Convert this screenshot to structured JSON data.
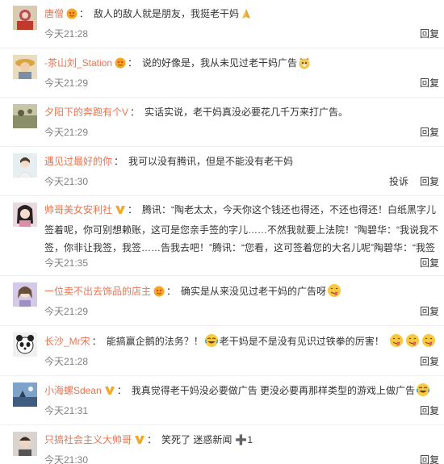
{
  "colors": {
    "username": "#eb7350",
    "text": "#333333",
    "time": "#808080",
    "vip_badge": "#f5a623",
    "divider": "#eeeeee"
  },
  "comments": [
    {
      "username": "唐僧",
      "badge": "vip-face-badge",
      "colon": "：",
      "text": "敌人的敌人就是朋友，我挺老干妈",
      "trailing_emoji": "pray-hands-emoji",
      "time": "今天21:28",
      "actions": [
        "回复"
      ]
    },
    {
      "username": "-茶山刘_Station",
      "badge": "vip-face-badge",
      "colon": "：",
      "text": "说的好像是，我从未见过老干妈广告",
      "trailing_emoji": "doge-emoji",
      "time": "今天21:29",
      "actions": [
        "回复"
      ]
    },
    {
      "username": "夕阳下的奔跑有个V",
      "colon": "：",
      "text": "实话实说，老干妈真没必要花几千万来打广告。",
      "time": "今天21:29",
      "actions": [
        "回复"
      ]
    },
    {
      "username": "遇见过最好的你",
      "colon": "：",
      "text": "我可以没有腾讯，但是不能没有老干妈",
      "time": "今天21:30",
      "actions": [
        "投诉",
        "回复"
      ]
    },
    {
      "username": "帅哥美女安利社",
      "badge": "v-badge",
      "colon": "：",
      "text": "腾讯：“陶老太太，今天你这个钱还也得还，不还也得还！白纸黑字儿签着呢，你可别想赖账，这可是您亲手签的字儿……不然我就要上法院！”陶碧华：“我说我不签，你非让我签，我签……告我去吧！”腾讯：“您看，这可签着您的大名儿呢”陶碧华：“我签的是啥？！”腾讯：“老干妈？！”",
      "time": "今天21:35",
      "actions": [
        "回复"
      ]
    },
    {
      "username": "一位卖不出去饰品的店主",
      "badge": "vip-face-badge",
      "colon": "：",
      "text": "确实是从来没见过老干妈的广告呀",
      "trailing_emoji": "tongue-face-emoji",
      "time": "今天21:29",
      "actions": [
        "回复"
      ]
    },
    {
      "username": "长沙_Mr宋",
      "colon": "：",
      "text": "能搞赢企鹅的法务？！",
      "mid_emoji": "laugh-cry-emoji",
      "text2": "老干妈是不是没有见识过铁拳的厉害！",
      "trailing_emojis": [
        "tongue-face-emoji",
        "tongue-face-emoji",
        "tongue-face-emoji"
      ],
      "time": "今天21:28",
      "actions": [
        "回复"
      ]
    },
    {
      "username": "小海螺Sdean",
      "badge": "v-badge",
      "colon": "：",
      "text": "我真觉得老干妈没必要做广告 更没必要再那样类型的游戏上做广告",
      "trailing_emoji": "laugh-cry-emoji",
      "time": "今天21:31",
      "actions": [
        "回复"
      ]
    },
    {
      "username": "只搞社会主义大帅哥",
      "badge": "v-badge",
      "colon": "：",
      "text": "笑死了 迷惑新闻",
      "plus": "➕",
      "plus_text": "1",
      "time": "今天21:30",
      "actions": [
        "回复"
      ]
    }
  ]
}
